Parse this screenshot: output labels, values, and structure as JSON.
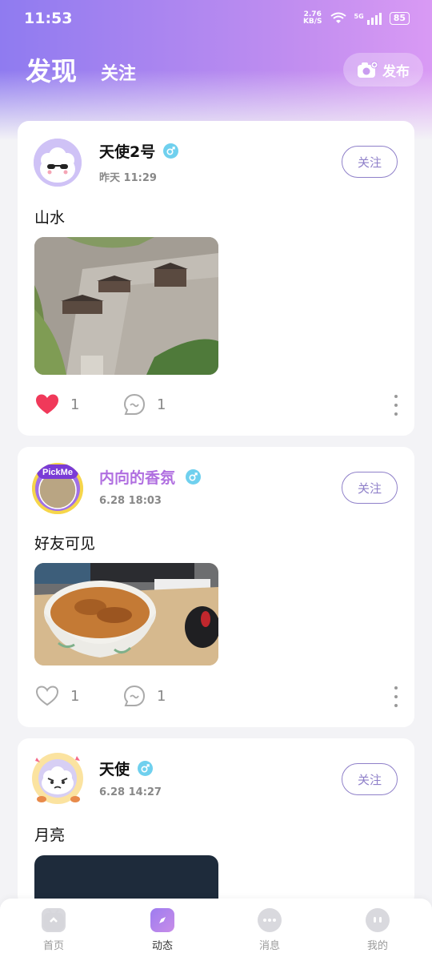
{
  "status_bar": {
    "time": "11:53",
    "net_speed_value": "2.76",
    "net_speed_unit": "KB/S",
    "network": "5G",
    "battery": "85"
  },
  "header": {
    "tab_discover": "发现",
    "tab_follow": "关注",
    "publish_label": "发布"
  },
  "posts": [
    {
      "user": "天使2号",
      "time": "昨天 11:29",
      "follow_label": "关注",
      "text": "山水",
      "likes": "1",
      "comments": "1",
      "liked": true
    },
    {
      "user": "内向的香氛",
      "avatar_badge": "PickMe",
      "time": "6.28 18:03",
      "follow_label": "关注",
      "text": "好友可见",
      "likes": "1",
      "comments": "1",
      "liked": false
    },
    {
      "user": "天使",
      "time": "6.28 14:27",
      "follow_label": "关注",
      "text": "月亮"
    }
  ],
  "bottom_nav": {
    "items": [
      {
        "label": "首页",
        "icon": "tv-icon"
      },
      {
        "label": "动态",
        "icon": "compass-icon"
      },
      {
        "label": "消息",
        "icon": "chat-bubble-icon"
      },
      {
        "label": "我的",
        "icon": "profile-face-icon"
      }
    ],
    "active_index": 1
  },
  "colors": {
    "accent": "#8f80c9",
    "like_red": "#f0395a",
    "vip_name": "#b06fe0",
    "gender_blue": "#6fd0ee"
  }
}
